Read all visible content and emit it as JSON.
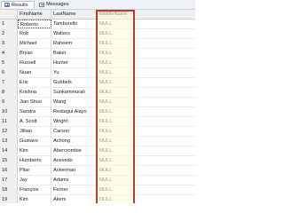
{
  "tabs": {
    "results": {
      "label": "Results",
      "icon": "grid-icon"
    },
    "messages": {
      "label": "Messages",
      "icon": "message-icon"
    }
  },
  "grid": {
    "columns": [
      "",
      "FirstName",
      "LastName",
      "MiddleName"
    ],
    "rows": [
      {
        "num": "1",
        "first": "Roberto",
        "last": "Tamburello",
        "middle": "NULL"
      },
      {
        "num": "2",
        "first": "Rob",
        "last": "Walters",
        "middle": "NULL"
      },
      {
        "num": "3",
        "first": "Michael",
        "last": "Raheem",
        "middle": "NULL"
      },
      {
        "num": "4",
        "first": "Bryan",
        "last": "Baker",
        "middle": "NULL"
      },
      {
        "num": "5",
        "first": "Russell",
        "last": "Hunter",
        "middle": "NULL"
      },
      {
        "num": "6",
        "first": "Nuan",
        "last": "Yu",
        "middle": "NULL"
      },
      {
        "num": "7",
        "first": "Eric",
        "last": "Gubbels",
        "middle": "NULL"
      },
      {
        "num": "8",
        "first": "Krishna",
        "last": "Sunkammurali",
        "middle": "NULL"
      },
      {
        "num": "9",
        "first": "Jian Shuo",
        "last": "Wang",
        "middle": "NULL"
      },
      {
        "num": "10",
        "first": "Sandra",
        "last": "Reátegui Alayo",
        "middle": "NULL"
      },
      {
        "num": "11",
        "first": "A. Scott",
        "last": "Wright",
        "middle": "NULL"
      },
      {
        "num": "12",
        "first": "Jillian",
        "last": "Carson",
        "middle": "NULL"
      },
      {
        "num": "13",
        "first": "Gustavo",
        "last": "Achong",
        "middle": "NULL"
      },
      {
        "num": "14",
        "first": "Kim",
        "last": "Abercrombie",
        "middle": "NULL"
      },
      {
        "num": "15",
        "first": "Humberto",
        "last": "Acevedo",
        "middle": "NULL"
      },
      {
        "num": "16",
        "first": "Pilar",
        "last": "Ackerman",
        "middle": "NULL"
      },
      {
        "num": "17",
        "first": "Jay",
        "last": "Adams",
        "middle": "NULL"
      },
      {
        "num": "18",
        "first": "François",
        "last": "Ferrier",
        "middle": "NULL"
      },
      {
        "num": "19",
        "first": "Kim",
        "last": "Akers",
        "middle": "NULL"
      }
    ]
  },
  "colors": {
    "highlight_border": "#c0392b"
  }
}
